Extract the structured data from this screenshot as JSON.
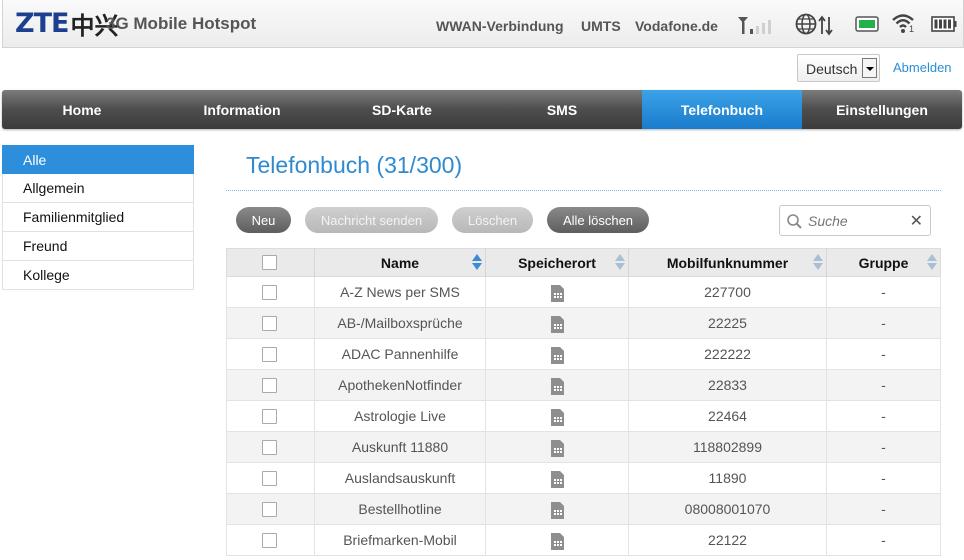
{
  "header": {
    "logo_text": "ZTE",
    "logo_cn": "中兴",
    "product": "3G Mobile Hotspot",
    "connection": "WWAN-Verbindung",
    "network_type": "UMTS",
    "provider": "Vodafone.de",
    "wifi_clients": "1",
    "icons": [
      "signal-strength-icon",
      "globe-data-icon",
      "sim-status-icon",
      "wifi-icon",
      "battery-icon"
    ]
  },
  "topbar": {
    "language": "Deutsch",
    "logout": "Abmelden"
  },
  "nav": {
    "items": [
      "Home",
      "Information",
      "SD-Karte",
      "SMS",
      "Telefonbuch",
      "Einstellungen"
    ],
    "active": "Telefonbuch"
  },
  "sidebar": {
    "items": [
      "Alle",
      "Allgemein",
      "Familienmitglied",
      "Freund",
      "Kollege"
    ],
    "active": "Alle"
  },
  "page": {
    "title": "Telefonbuch (31/300)"
  },
  "toolbar": {
    "new": "Neu",
    "send": "Nachricht senden",
    "delete": "Löschen",
    "delete_all": "Alle löschen",
    "search_placeholder": "Suche"
  },
  "table": {
    "columns": [
      "Name",
      "Speicherort",
      "Mobilfunknummer",
      "Gruppe"
    ],
    "rows": [
      {
        "name": "A-Z News per SMS",
        "location": "sim-card-icon",
        "number": "227700",
        "group": "-"
      },
      {
        "name": "AB-/Mailboxsprüche",
        "location": "sim-card-icon",
        "number": "22225",
        "group": "-"
      },
      {
        "name": "ADAC Pannenhilfe",
        "location": "sim-card-icon",
        "number": "222222",
        "group": "-"
      },
      {
        "name": "ApothekenNotfinder",
        "location": "sim-card-icon",
        "number": "22833",
        "group": "-"
      },
      {
        "name": "Astrologie Live",
        "location": "sim-card-icon",
        "number": "22464",
        "group": "-"
      },
      {
        "name": "Auskunft 11880",
        "location": "sim-card-icon",
        "number": "118802899",
        "group": "-"
      },
      {
        "name": "Auslandsauskunft",
        "location": "sim-card-icon",
        "number": "11890",
        "group": "-"
      },
      {
        "name": "Bestellhotline",
        "location": "sim-card-icon",
        "number": "08008001070",
        "group": "-"
      },
      {
        "name": "Briefmarken-Mobil",
        "location": "sim-card-icon",
        "number": "22122",
        "group": "-"
      }
    ]
  },
  "colors": {
    "accent": "#2d8fdc",
    "title": "#2f8ad0",
    "nav_dark": "#4d4d4d"
  }
}
